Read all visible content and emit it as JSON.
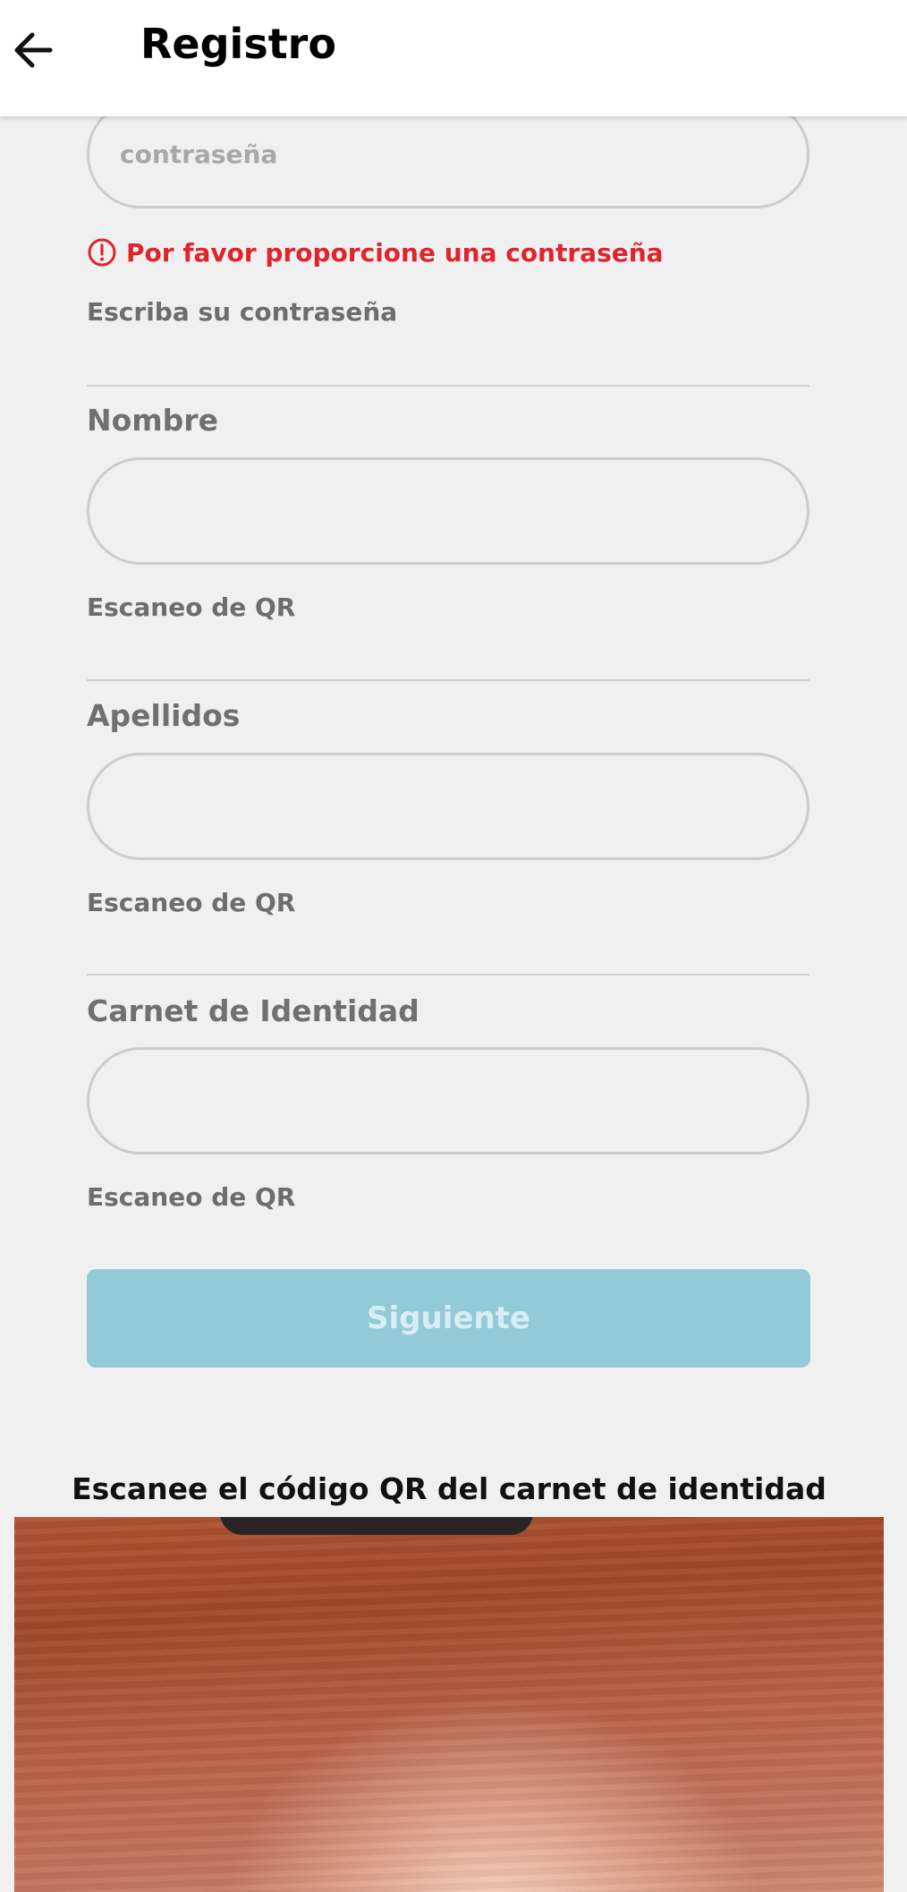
{
  "app_bar": {
    "title": "Registro",
    "back_icon": "arrow-left-icon"
  },
  "password_field": {
    "placeholder": "contraseña",
    "value": "",
    "error_icon": "alert-circle-icon",
    "error": "Por favor proporcione una contraseña",
    "helper": "Escriba su contraseña"
  },
  "name_field": {
    "label": "Nombre",
    "value": "",
    "helper": "Escaneo de QR"
  },
  "surname_field": {
    "label": "Apellidos",
    "value": "",
    "helper": "Escaneo de QR"
  },
  "id_field": {
    "label": "Carnet de Identidad",
    "value": "",
    "helper": "Escaneo de QR"
  },
  "next_button": {
    "label": "Siguiente"
  },
  "scanner": {
    "caption": "Escanee el código QR del carnet de identidad"
  },
  "colors": {
    "error": "#e0242c",
    "button_disabled": "#93cad8",
    "background": "#f0f0f0"
  }
}
